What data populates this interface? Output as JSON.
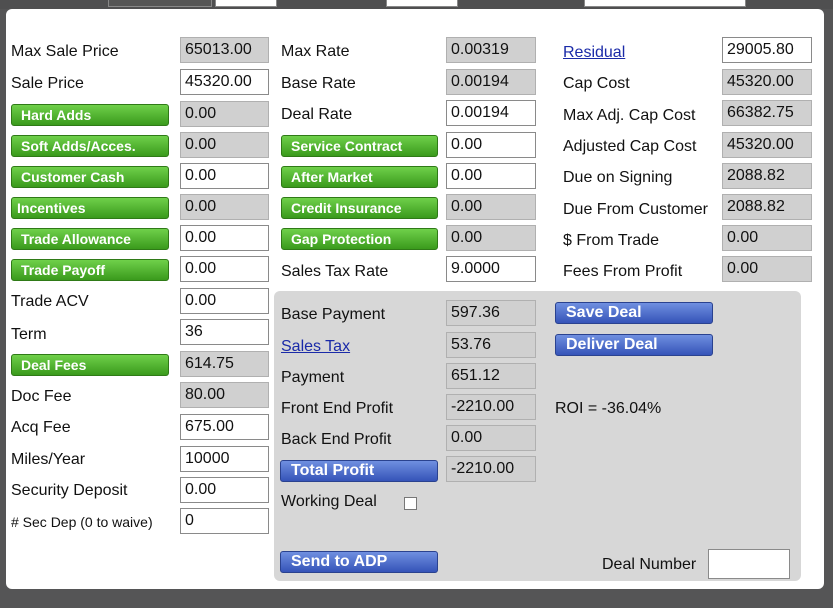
{
  "col1": {
    "max_sale_price_label": "Max Sale Price",
    "max_sale_price": "65013.00",
    "sale_price_label": "Sale Price",
    "sale_price": "45320.00",
    "hard_adds_label": "Hard Adds",
    "hard_adds": "0.00",
    "soft_adds_label": "Soft Adds/Acces.",
    "soft_adds": "0.00",
    "customer_cash_label": "Customer Cash",
    "customer_cash": "0.00",
    "incentives_label": "Incentives",
    "incentives": "0.00",
    "trade_allowance_label": "Trade Allowance",
    "trade_allowance": "0.00",
    "trade_payoff_label": "Trade Payoff",
    "trade_payoff": "0.00",
    "trade_acv_label": "Trade ACV",
    "trade_acv": "0.00",
    "term_label": "Term",
    "term": "36",
    "deal_fees_label": "Deal Fees",
    "deal_fees": "614.75",
    "doc_fee_label": "Doc Fee",
    "doc_fee": "80.00",
    "acq_fee_label": "Acq Fee",
    "acq_fee": "675.00",
    "miles_year_label": "Miles/Year",
    "miles_year": "10000",
    "security_deposit_label": "Security Deposit",
    "security_deposit": "0.00",
    "sec_dep_count_label": "# Sec Dep (0 to waive)",
    "sec_dep_count": "0"
  },
  "col2": {
    "max_rate_label": "Max Rate",
    "max_rate": "0.00319",
    "base_rate_label": "Base Rate",
    "base_rate": "0.00194",
    "deal_rate_label": "Deal Rate",
    "deal_rate": "0.00194",
    "service_contract_label": "Service Contract",
    "service_contract": "0.00",
    "after_market_label": "After Market",
    "after_market": "0.00",
    "credit_insurance_label": "Credit Insurance",
    "credit_insurance": "0.00",
    "gap_protection_label": "Gap Protection",
    "gap_protection": "0.00",
    "sales_tax_rate_label": "Sales Tax Rate",
    "sales_tax_rate": "9.0000"
  },
  "col3": {
    "residual_label": "Residual",
    "residual": "29005.80",
    "cap_cost_label": "Cap Cost",
    "cap_cost": "45320.00",
    "max_adj_cap_cost_label": "Max Adj. Cap Cost",
    "max_adj_cap_cost": "66382.75",
    "adjusted_cap_cost_label": "Adjusted Cap Cost",
    "adjusted_cap_cost": "45320.00",
    "due_on_signing_label": "Due on Signing",
    "due_on_signing": "2088.82",
    "due_from_customer_label": "Due From Customer",
    "due_from_customer": "2088.82",
    "from_trade_label": "$ From Trade",
    "from_trade": "0.00",
    "fees_from_profit_label": "Fees From Profit",
    "fees_from_profit": "0.00"
  },
  "summary": {
    "base_payment_label": "Base Payment",
    "base_payment": "597.36",
    "sales_tax_label": "Sales Tax",
    "sales_tax": "53.76",
    "payment_label": "Payment",
    "payment": "651.12",
    "front_end_profit_label": "Front End Profit",
    "front_end_profit": "-2210.00",
    "back_end_profit_label": "Back End Profit",
    "back_end_profit": "0.00",
    "total_profit_label": "Total Profit",
    "total_profit": "-2210.00",
    "working_deal_label": "Working Deal",
    "working_deal_checked": false,
    "roi_text": "ROI = -36.04%",
    "deal_number_label": "Deal Number",
    "deal_number": ""
  },
  "actions": {
    "save_deal": "Save Deal",
    "deliver_deal": "Deliver Deal",
    "send_to_adp": "Send to ADP"
  },
  "colors": {
    "background": "#555556",
    "green_button": "#4fb52c",
    "blue_button": "#3f60c4",
    "readonly_field": "#d0d0d0",
    "link": "#1a2aa8"
  }
}
